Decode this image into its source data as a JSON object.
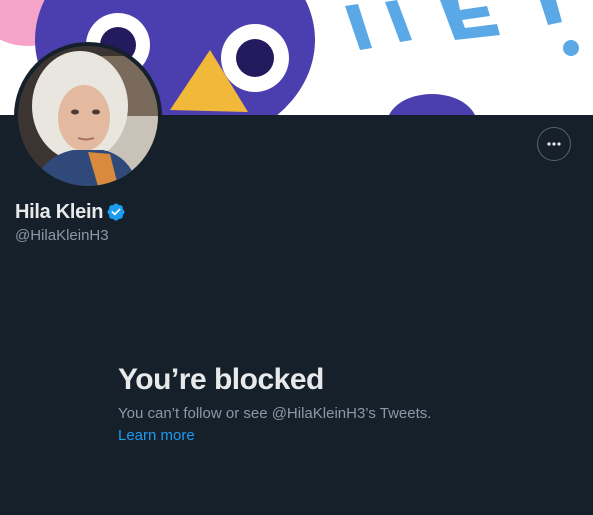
{
  "profile": {
    "display_name": "Hila Klein",
    "handle": "@HilaKleinH3",
    "verified": true
  },
  "banner": {
    "lettering": "BYE!"
  },
  "actions": {
    "more_icon": "more-horizontal-icon"
  },
  "blocked": {
    "title": "You’re blocked",
    "message": "You can’t follow or see @HilaKleinH3’s Tweets.",
    "link": "Learn more"
  },
  "colors": {
    "background": "#15202b",
    "text_primary": "#e7e9ea",
    "text_secondary": "#8b98a5",
    "link": "#1d9bf0",
    "verified_badge": "#1d9bf0"
  }
}
